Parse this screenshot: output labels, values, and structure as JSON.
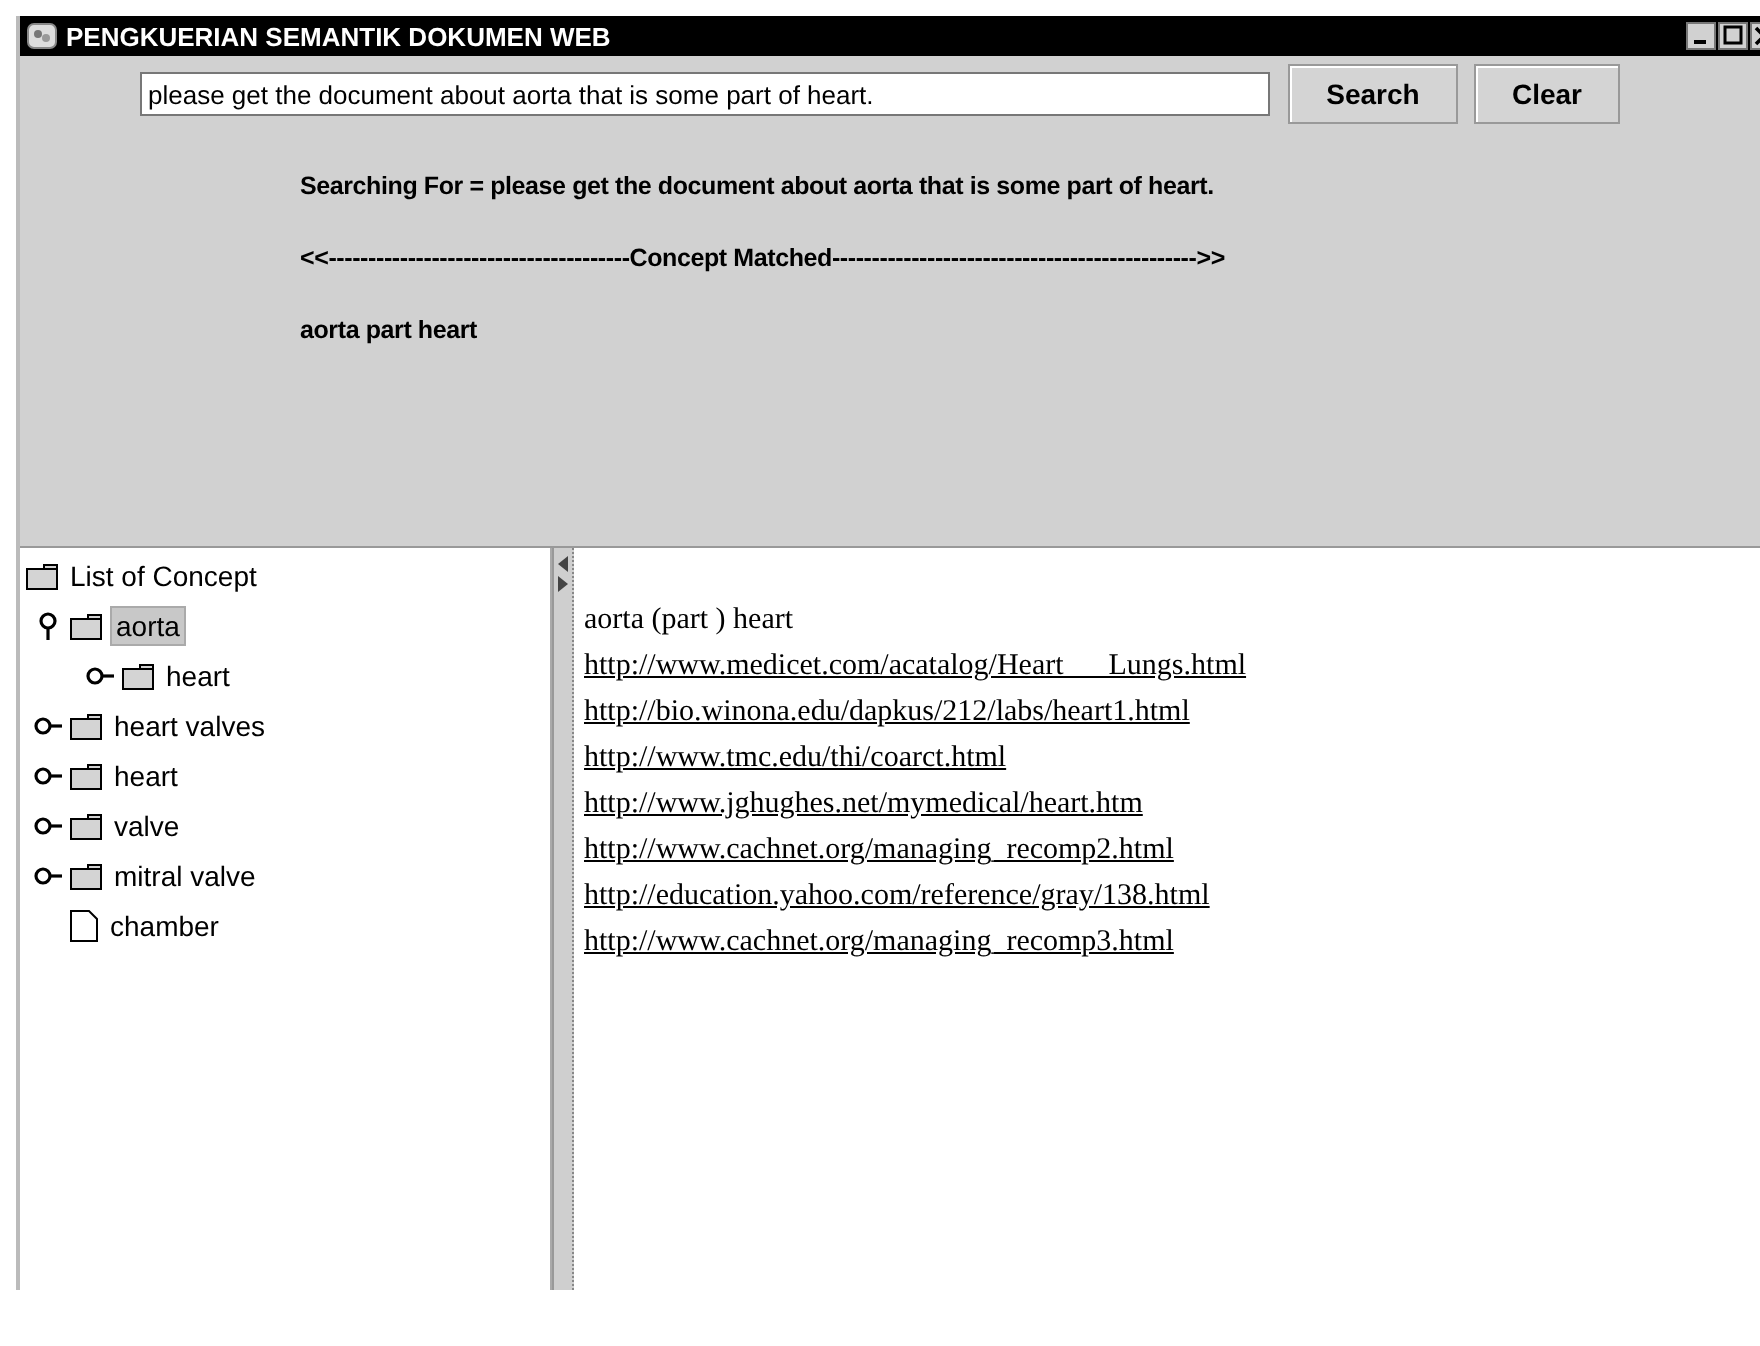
{
  "window": {
    "title": "PENGKUERIAN SEMANTIK DOKUMEN WEB"
  },
  "search": {
    "value": "please get the document about aorta that is some part of heart."
  },
  "buttons": [
    "Search",
    "Clear"
  ],
  "info": {
    "searching_for": "Searching For = please get the document about aorta that is some part of heart.",
    "separator": "<<--------------------------------------Concept Matched---------------------------------------------->>",
    "concepts": "aorta part heart"
  },
  "tree": {
    "label": "List of Concept",
    "kind": "folder",
    "expanded": true,
    "selected": false,
    "children": [
      {
        "label": "aorta",
        "kind": "folder",
        "expanded": true,
        "selected": true,
        "children": [
          {
            "label": "heart",
            "kind": "folder",
            "expanded": false,
            "selected": false
          }
        ]
      },
      {
        "label": "heart valves",
        "kind": "folder",
        "expanded": false,
        "selected": false
      },
      {
        "label": "heart",
        "kind": "folder",
        "expanded": false,
        "selected": false
      },
      {
        "label": "valve",
        "kind": "folder",
        "expanded": false,
        "selected": false
      },
      {
        "label": "mitral valve",
        "kind": "folder",
        "expanded": false,
        "selected": false
      },
      {
        "label": "chamber",
        "kind": "leaf",
        "selected": false
      }
    ]
  },
  "results": {
    "heading": "aorta (part ) heart",
    "links": [
      "http://www.medicet.com/acatalog/Heart___Lungs.html",
      "http://bio.winona.edu/dapkus/212/labs/heart1.html",
      "http://www.tmc.edu/thi/coarct.html",
      "http://www.jghughes.net/mymedical/heart.htm",
      "http://www.cachnet.org/managing_recomp2.html",
      "http://education.yahoo.com/reference/gray/138.html",
      "http://www.cachnet.org/managing_recomp3.html"
    ]
  }
}
